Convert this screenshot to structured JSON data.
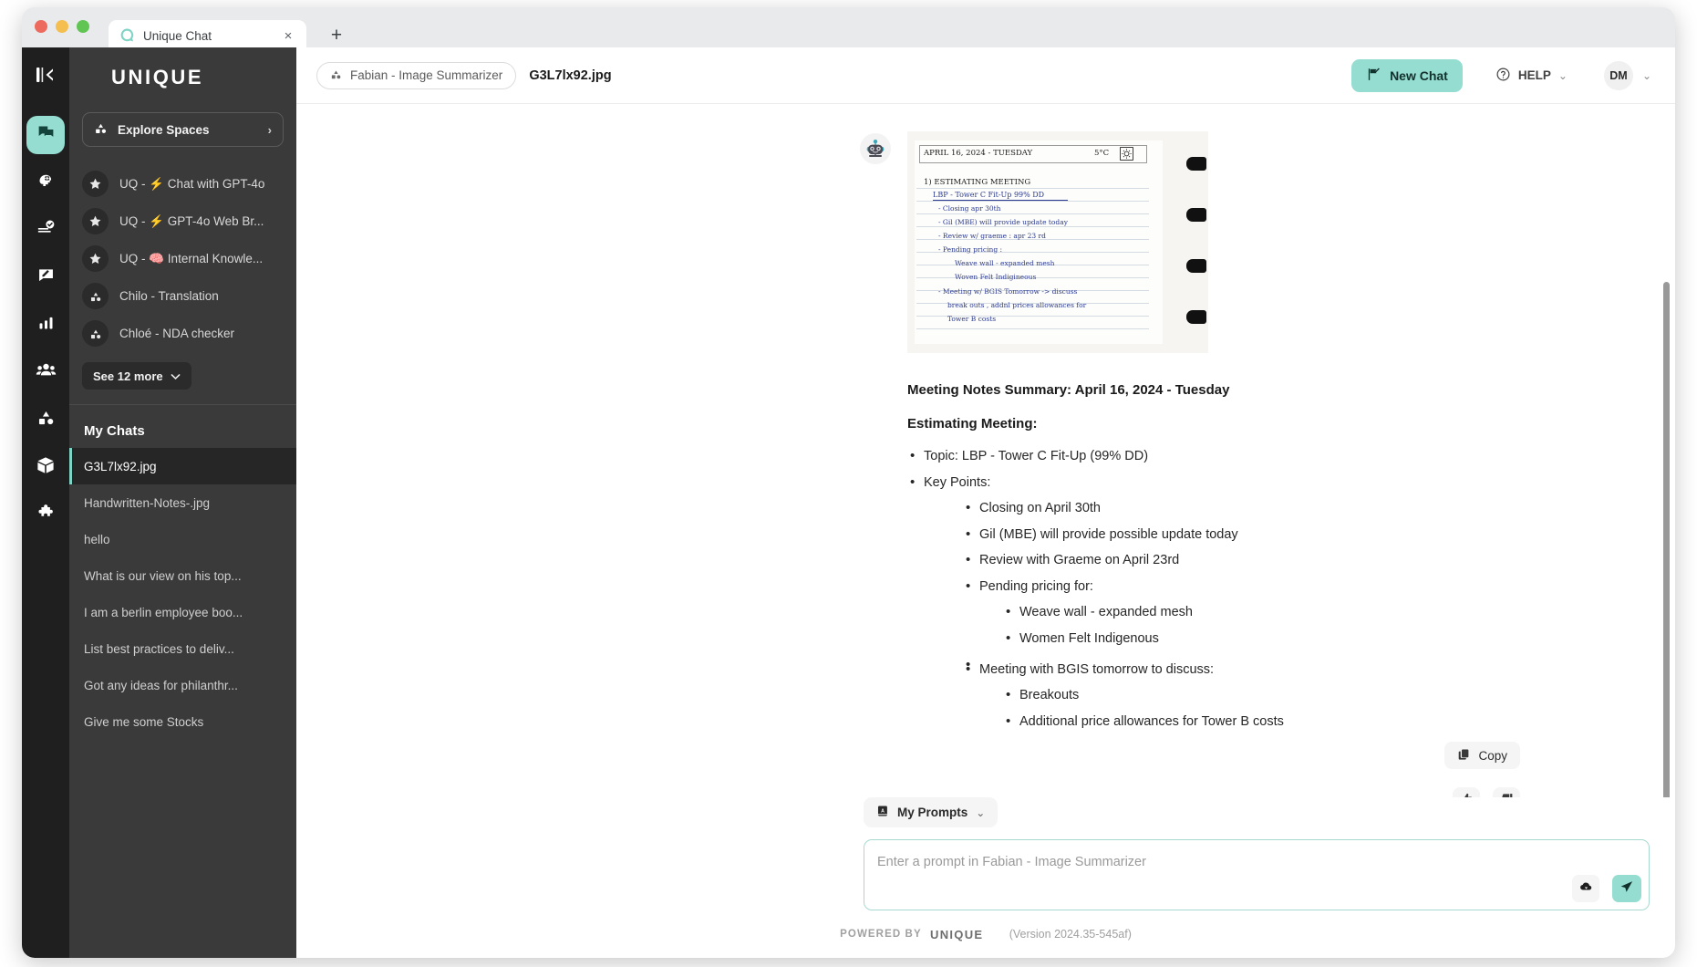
{
  "browser": {
    "tab_title": "Unique Chat",
    "favicon": "unique-logo-icon",
    "close_label": "×",
    "new_tab_label": "+"
  },
  "rail": {
    "logo": "collapse-sidebar-icon",
    "items": [
      {
        "name": "chat",
        "icon": "chat-bubbles-icon",
        "active": true
      },
      {
        "name": "assistants",
        "icon": "brain-gear-icon",
        "active": false
      },
      {
        "name": "tasks",
        "icon": "checklist-icon",
        "active": false
      },
      {
        "name": "prompts",
        "icon": "message-edit-icon",
        "active": false
      },
      {
        "name": "analytics",
        "icon": "bar-chart-icon",
        "active": false
      },
      {
        "name": "people",
        "icon": "users-icon",
        "active": false
      },
      {
        "name": "spaces",
        "icon": "spaces-icon",
        "active": false
      },
      {
        "name": "knowledge",
        "icon": "box-icon",
        "active": false
      },
      {
        "name": "integrations",
        "icon": "puzzle-piece-icon",
        "active": false
      }
    ]
  },
  "sidebar": {
    "brand": "UNIQUE",
    "explore_spaces": {
      "label": "Explore Spaces",
      "icon": "spaces-icon",
      "chevron": "›"
    },
    "spaces": [
      {
        "label": "UQ - ⚡ Chat with GPT-4o",
        "icon": "star-icon",
        "emoji": "⚡"
      },
      {
        "label": "UQ - ⚡ GPT-4o Web Br...",
        "icon": "star-icon",
        "emoji": "⚡"
      },
      {
        "label": "UQ - 🧠 Internal Knowle...",
        "icon": "star-icon",
        "emoji": "🧠"
      },
      {
        "label": "Chilo - Translation",
        "icon": "spaces-icon",
        "emoji": ""
      },
      {
        "label": "Chloé - NDA checker",
        "icon": "spaces-icon",
        "emoji": ""
      }
    ],
    "see_more": {
      "label": "See 12 more",
      "chevron": "⌄"
    },
    "my_chats_title": "My Chats",
    "chats": [
      {
        "label": "G3L7lx92.jpg",
        "active": true
      },
      {
        "label": "Handwritten-Notes-.jpg",
        "active": false
      },
      {
        "label": "hello",
        "active": false
      },
      {
        "label": "What is our view on his top...",
        "active": false
      },
      {
        "label": "I am a berlin employee boo...",
        "active": false
      },
      {
        "label": "List best practices to deliv...",
        "active": false
      },
      {
        "label": "Got any ideas for philanthr...",
        "active": false
      },
      {
        "label": "Give me some Stocks",
        "active": false
      }
    ]
  },
  "topbar": {
    "assistant_chip": {
      "label": "Fabian - Image Summarizer",
      "icon": "spaces-icon"
    },
    "doc_title": "G3L7lx92.jpg",
    "new_chat": {
      "label": "New Chat",
      "icon": "new-chat-flag-icon"
    },
    "help": {
      "label": "HELP",
      "icon": "question-circle-icon",
      "chevron": "⌄"
    },
    "user": {
      "initials": "DM",
      "chevron": "⌄"
    }
  },
  "message": {
    "avatar": "robot-avatar-icon",
    "attachment": {
      "name": "handwritten-note-image",
      "date_line": "APRIL 16, 2024 - TUESDAY",
      "temperature": "5°C",
      "weather_icon": "sun-icon",
      "lines": [
        "1) ESTIMATING MEETING",
        "LBP - Tower C Fit-Up 99% DD",
        "- Closing apr 30th",
        "- Gil (MBE) will provide update today",
        "- Review w/ graeme : apr 23 rd",
        "- Pending pricing :",
        "Weave wall - expanded mesh",
        "Woven Felt Indigineous",
        "- Meeting w/ BGIS Tomorrow -> discuss",
        "break outs , addnl prices allowances for",
        "Tower B costs"
      ]
    },
    "title": "Meeting Notes Summary: April 16, 2024 - Tuesday",
    "subtitle": "Estimating Meeting:",
    "bullets": [
      {
        "text": "Topic: LBP - Tower C Fit-Up (99% DD)",
        "level": 1
      },
      {
        "text": "Key Points:",
        "level": 1
      },
      {
        "text": "Closing on April 30th",
        "level": 2
      },
      {
        "text": "Gil (MBE) will provide possible update today",
        "level": 2
      },
      {
        "text": "Review with Graeme on April 23rd",
        "level": 2
      },
      {
        "text": "Pending pricing for:",
        "level": 2
      },
      {
        "text": "Weave wall - expanded mesh",
        "level": 3
      },
      {
        "text": "Women Felt Indigenous",
        "level": 3
      },
      {
        "text": "Meeting with BGIS tomorrow to discuss:",
        "level": 2
      },
      {
        "text": "Breakouts",
        "level": 3
      },
      {
        "text": "Additional price allowances for Tower B costs",
        "level": 3
      }
    ],
    "copy": {
      "label": "Copy",
      "icon": "copy-icon"
    },
    "thumbs_up": "thumbs-up-icon",
    "thumbs_down": "thumbs-down-icon"
  },
  "composer": {
    "my_prompts": {
      "label": "My Prompts",
      "icon": "book-a-icon",
      "chevron": "⌄"
    },
    "placeholder": "Enter a prompt in Fabian - Image Summarizer",
    "upload_icon": "upload-cloud-icon",
    "send_icon": "send-paper-plane-icon"
  },
  "footer": {
    "powered_by": "POWERED BY",
    "brand": "UNIQUE",
    "version": "(Version 2024.35-545af)"
  },
  "colors": {
    "accent": "#96ddd1",
    "rail_bg": "#1f1f1f",
    "sidebar_bg": "#3a3a3a",
    "active_chat_bg": "#262626",
    "active_marker": "#7fd4c6"
  }
}
